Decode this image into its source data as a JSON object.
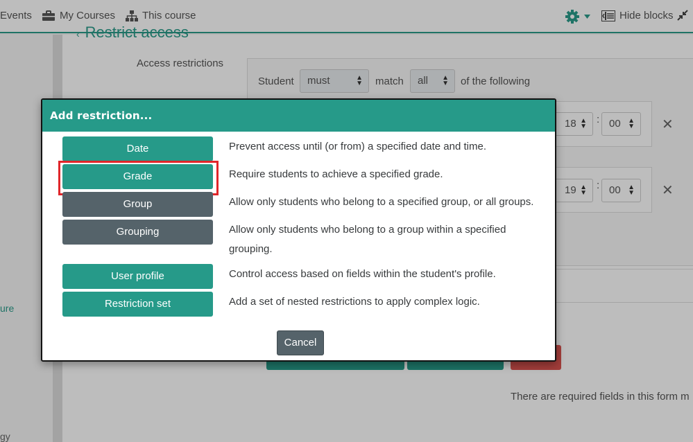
{
  "navbar": {
    "events": "Events",
    "my_courses": "My Courses",
    "this_course": "This course",
    "hide_blocks": "Hide blocks"
  },
  "sidebar": {
    "frag1": "ure",
    "frag2": "gy"
  },
  "background": {
    "heading": "Restrict access",
    "access_restrictions_label": "Access restrictions",
    "student": "Student",
    "must": "must",
    "match": "match",
    "all": "all",
    "of_the_following": "of the following",
    "hour1": "18",
    "min1": "00",
    "hour2": "19",
    "min2": "00",
    "required_note": "There are required fields in this form m"
  },
  "modal": {
    "title": "Add restriction...",
    "options": [
      {
        "label": "Date",
        "description": "Prevent access until (or from) a specified date and time."
      },
      {
        "label": "Grade",
        "description": "Require students to achieve a specified grade."
      },
      {
        "label": "Group",
        "description": "Allow only students who belong to a specified group, or all groups."
      },
      {
        "label": "Grouping",
        "description": "Allow only students who belong to a group within a specified grouping."
      },
      {
        "label": "User profile",
        "description": "Control access based on fields within the student's profile."
      },
      {
        "label": "Restriction set",
        "description": "Add a set of nested restrictions to apply complex logic."
      }
    ],
    "cancel": "Cancel"
  },
  "colors": {
    "brand_teal": "#269a89",
    "slate_button": "#55636a",
    "highlight_red": "#e0262a",
    "danger_button": "#d9534f"
  }
}
